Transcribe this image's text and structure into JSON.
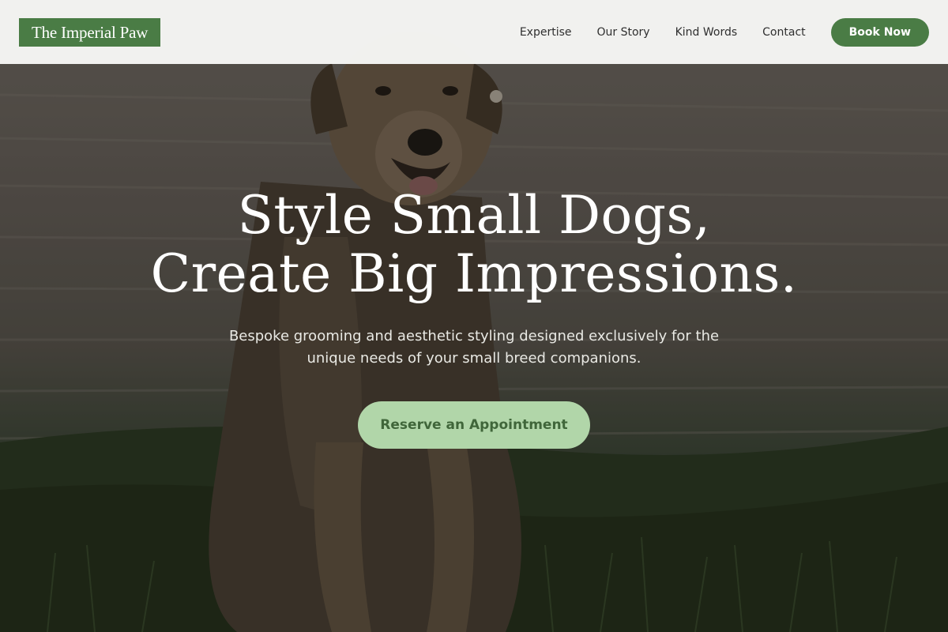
{
  "brand": {
    "name": "The Imperial Paw",
    "color": "#4a7c45"
  },
  "nav": {
    "items": [
      {
        "label": "Expertise"
      },
      {
        "label": "Our Story"
      },
      {
        "label": "Kind Words"
      },
      {
        "label": "Contact"
      }
    ],
    "book_label": "Book Now"
  },
  "hero": {
    "headline_line1": "Style Small Dogs,",
    "headline_line2": "Create Big Impressions.",
    "subtitle_line1": "Bespoke grooming and aesthetic styling designed exclusively for the",
    "subtitle_line2": "unique needs of your small breed companions.",
    "cta_label": "Reserve an Appointment",
    "cta_color": "#b1d6a9"
  }
}
